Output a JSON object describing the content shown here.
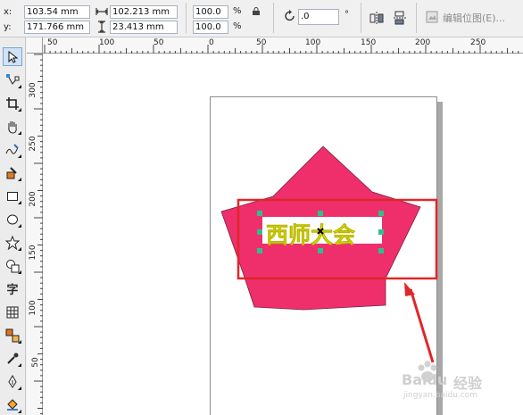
{
  "property_bar": {
    "x_label": "x:",
    "x_value": "103.54 mm",
    "y_label": "y:",
    "y_value": "171.766 mm",
    "width_value": "102.213 mm",
    "height_value": "23.413 mm",
    "scale_x": "100.0",
    "scale_y": "100.0",
    "percent_x": "%",
    "percent_y": "%",
    "rotation_value": ".0",
    "degree_symbol": "°",
    "edit_bitmap_label": "编辑位图(E)..."
  },
  "ruler_top": {
    "ticks": [
      "50",
      "100",
      "50",
      "0",
      "50",
      "100",
      "150",
      "200",
      "250"
    ]
  },
  "ruler_left": {
    "ticks": [
      "300",
      "250",
      "200",
      "150",
      "100",
      "50"
    ]
  },
  "canvas": {
    "star_color": "#ee2f6c",
    "text_object": "西师大会",
    "text_color": "#f5f000",
    "handle_color": "#2fbf8f",
    "highlight_color": "#e0262a"
  },
  "toolbox": {
    "tools": [
      "pick-tool",
      "shape-tool",
      "crop-tool",
      "pan-tool",
      "freehand-tool",
      "smart-fill-tool",
      "rectangle-tool",
      "ellipse-tool",
      "polygon-tool",
      "basic-shapes-tool",
      "text-tool",
      "table-tool",
      "interactive-tool",
      "eyedropper-tool",
      "outline-tool",
      "fill-tool"
    ],
    "text_tool_glyph": "字"
  },
  "watermark": {
    "brand": "Baidu",
    "sub": "经验",
    "url": "jingyan.baidu.com"
  }
}
